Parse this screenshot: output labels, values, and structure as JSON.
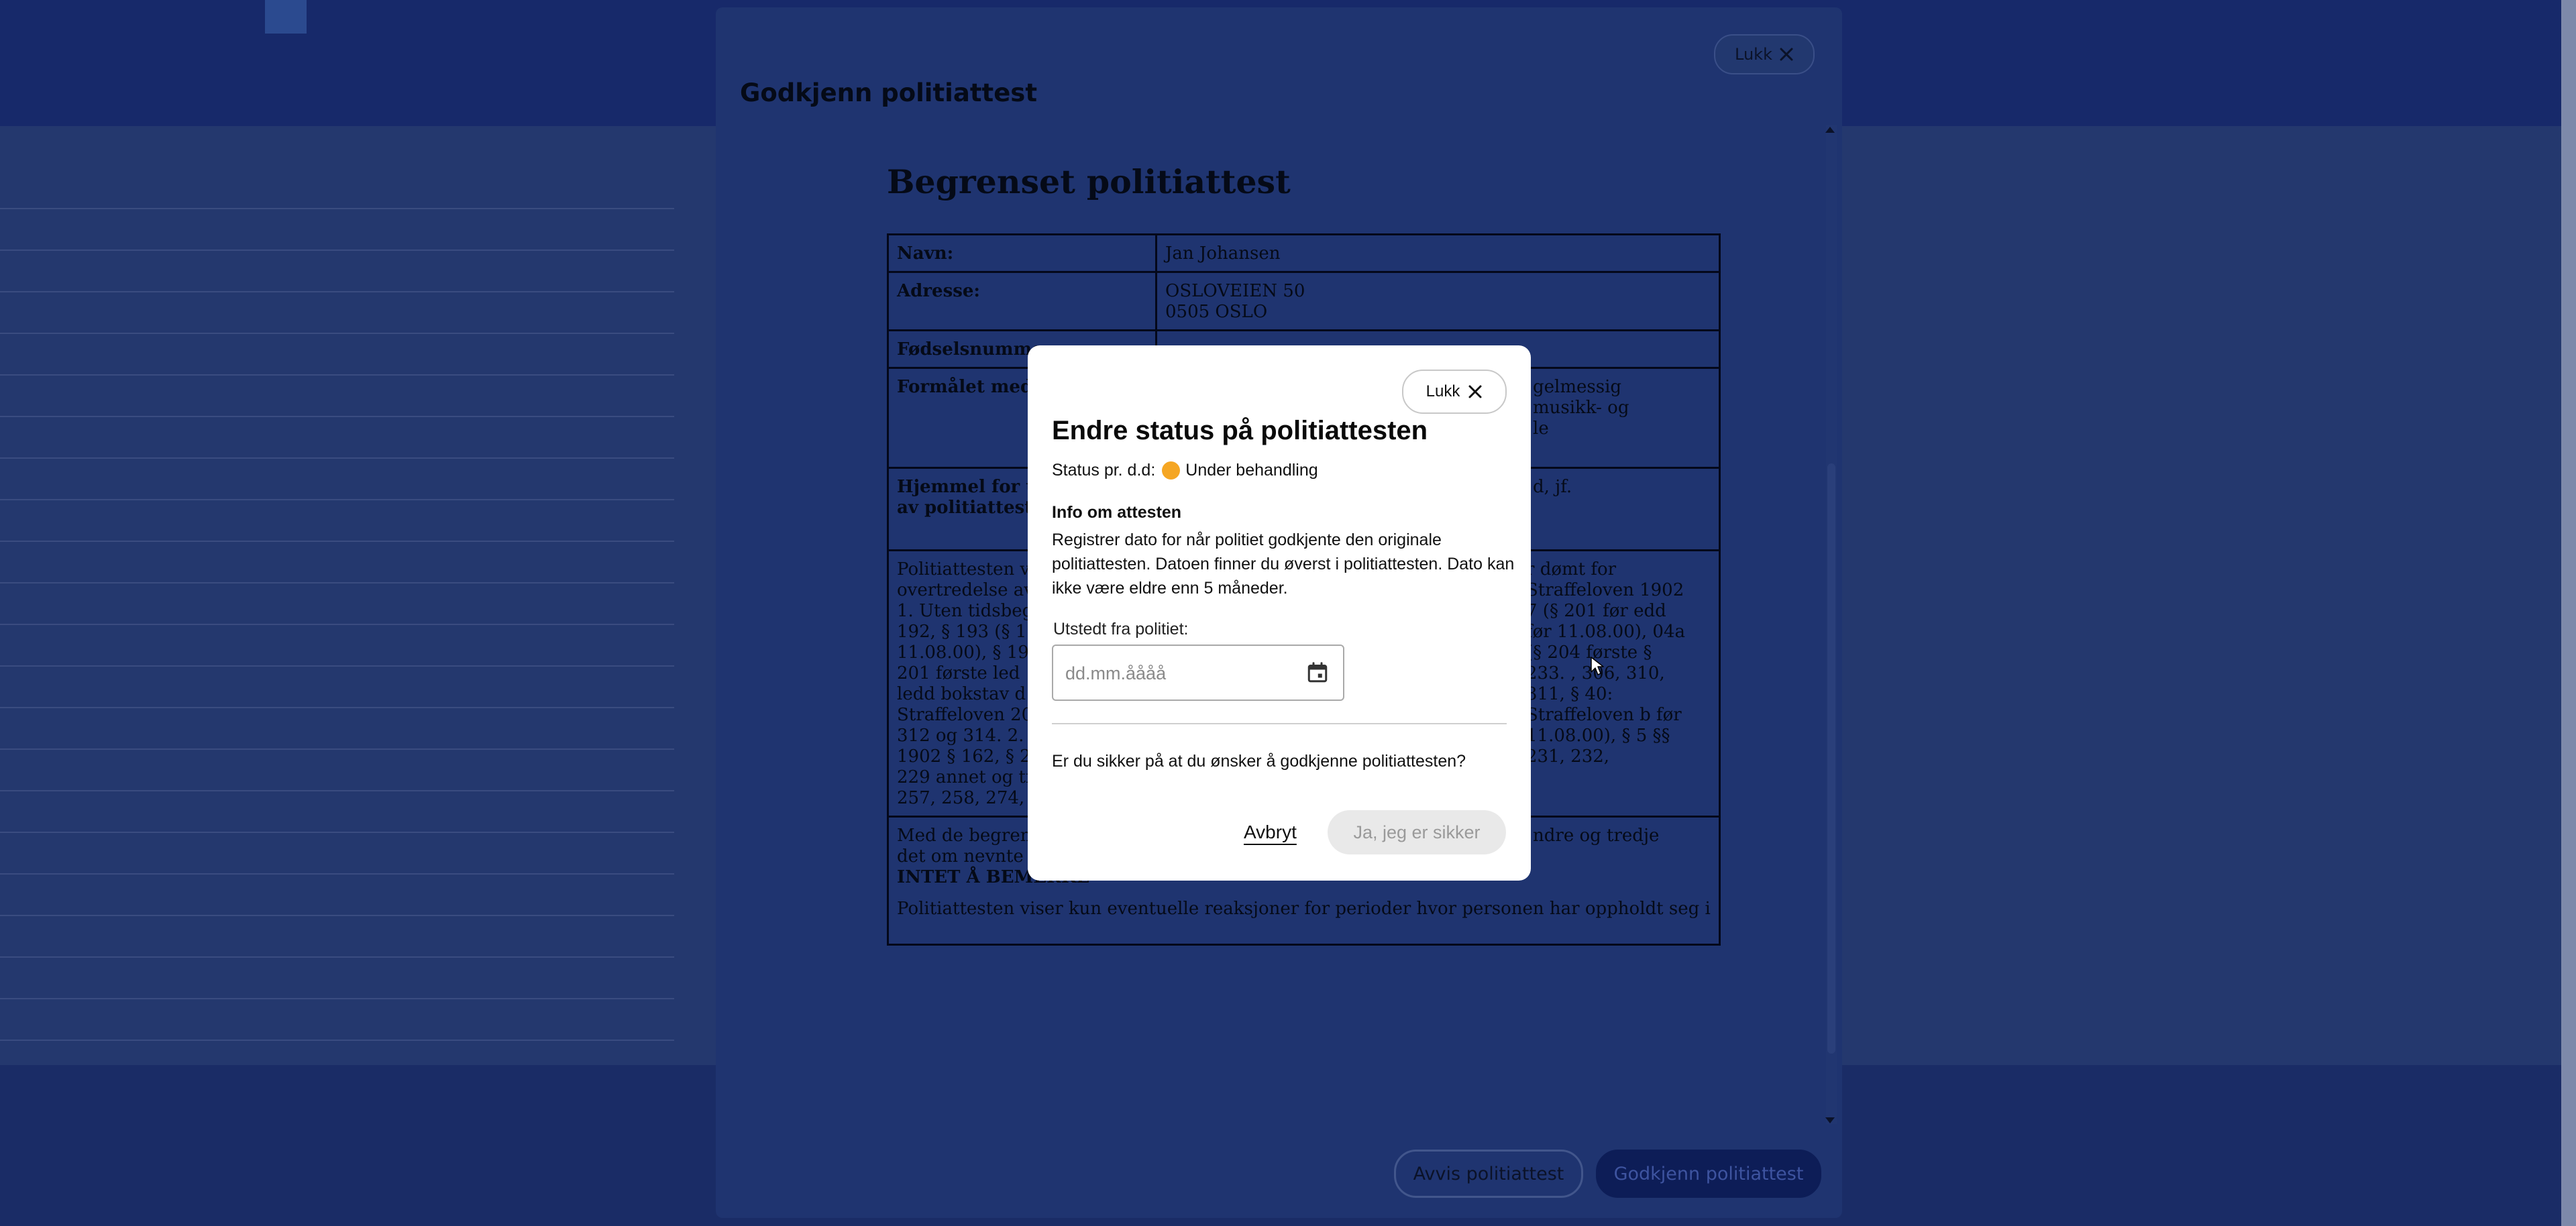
{
  "approve_modal": {
    "title": "Godkjenn politiattest",
    "close_label": "Lukk",
    "reject_button": "Avvis politiattest",
    "approve_button": "Godkjenn politiattest"
  },
  "document": {
    "heading": "Begrenset politiattest",
    "rows": [
      {
        "label": "Navn:",
        "value_lines": [
          "Jan Johansen"
        ]
      },
      {
        "label": "Adresse:",
        "value_lines": [
          "OSLOVEIEN 50",
          "0505 OSLO"
        ]
      },
      {
        "label": "Fødselsnummer:",
        "value_lines": [
          ""
        ]
      },
      {
        "label": "Formålet med attesten:",
        "value_lines": [
          "gelmessig",
          "musikk- og",
          "le"
        ]
      },
      {
        "label": "Hjemmel for utstedelse av politiattesten:",
        "value_lines": [
          "d, jf."
        ]
      }
    ],
    "body_left": "Politiattesten vi overtredelse av 1. Uten tidsbeg § 192, § 193 (§ 1 11.08.00), § 19 § 201 første led ledd bokstav d Straffeloven 20 312 og 314. 2. M 1902 § 162, § 20 229 annet og tr 257, 258, 274, 2",
    "body_right": "r dømt for Straffeloven 1902 7 (§ 201 før edd før 11.08.00), 04a (§ 204 første § 233. , 306, 310, 311, § 40: Straffeloven b før 11.08.00), § 5 §§ 231, 232,",
    "footer_line1": "Med de begrens tredje punktum, er det om nevnte person",
    "footer_line1_right": "ndre og tredje",
    "footer_line2": "INTET Å BEMERKE",
    "footer_line3": "Politiattesten viser kun eventuelle reaksjoner for perioder hvor personen har oppholdt seg i"
  },
  "status_dialog": {
    "close_label": "Lukk",
    "title": "Endre status på politiattesten",
    "status_prefix": "Status pr. d.d:",
    "status_value": "Under behandling",
    "status_color": "#f5a623",
    "info_heading": "Info om attesten",
    "info_text": "Registrer dato for når politiet godkjente den originale politiattesten. Datoen finner du øverst i politiattesten. Dato kan ikke være eldre enn 5 måneder.",
    "field_label": "Utstedt fra politiet:",
    "date_placeholder": "dd.mm.åååå",
    "date_value": "",
    "question": "Er du sikker på at du ønsker å godkjenne politiattesten?",
    "cancel_label": "Avbryt",
    "confirm_label": "Ja, jeg er sikker"
  },
  "icons": {
    "close": "close-icon",
    "calendar": "calendar-icon",
    "cursor": "mouse-cursor-icon"
  },
  "colors": {
    "overlay": "#20346b",
    "primary_dark": "#0d1d57",
    "status_pending": "#f5a623"
  }
}
